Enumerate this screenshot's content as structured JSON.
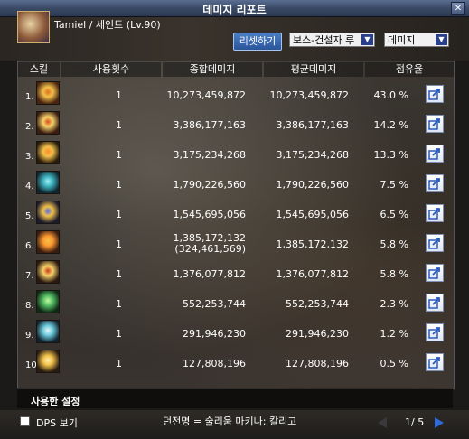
{
  "window": {
    "title": "데미지 리포트",
    "close_glyph": "✕"
  },
  "character": {
    "name": "Tamiel / 세인트 (Lv.90)"
  },
  "toolbar": {
    "reset_label": "리셋하기",
    "target_select": "보스-건설자 루",
    "mode_select": "데미지"
  },
  "table": {
    "headers": {
      "skill": "스킬",
      "count": "사용횟수",
      "total": "종합데미지",
      "avg": "평균데미지",
      "share": "점유율"
    },
    "rows": [
      {
        "rank": "1.",
        "count": "1",
        "total": "10,273,459,872",
        "avg": "10,273,459,872",
        "share": "43.0 %",
        "icon": "skill-icon-holy-1"
      },
      {
        "rank": "2.",
        "count": "1",
        "total": "3,386,177,163",
        "avg": "3,386,177,163",
        "share": "14.2 %",
        "icon": "skill-icon-holy-2"
      },
      {
        "rank": "3.",
        "count": "1",
        "total": "3,175,234,268",
        "avg": "3,175,234,268",
        "share": "13.3 %",
        "icon": "skill-icon-holy-3"
      },
      {
        "rank": "4.",
        "count": "1",
        "total": "1,790,226,560",
        "avg": "1,790,226,560",
        "share": "7.5 %",
        "icon": "skill-icon-holy-4"
      },
      {
        "rank": "5.",
        "count": "1",
        "total": "1,545,695,056",
        "avg": "1,545,695,056",
        "share": "6.5 %",
        "icon": "skill-icon-holy-5"
      },
      {
        "rank": "6.",
        "count": "1",
        "total": "1,385,172,132",
        "total_sub": "(324,461,569)",
        "avg": "1,385,172,132",
        "share": "5.8 %",
        "icon": "skill-icon-holy-6"
      },
      {
        "rank": "7.",
        "count": "1",
        "total": "1,376,077,812",
        "avg": "1,376,077,812",
        "share": "5.8 %",
        "icon": "skill-icon-holy-7"
      },
      {
        "rank": "8.",
        "count": "1",
        "total": "552,253,744",
        "avg": "552,253,744",
        "share": "2.3 %",
        "icon": "skill-icon-holy-8"
      },
      {
        "rank": "9.",
        "count": "1",
        "total": "291,946,230",
        "avg": "291,946,230",
        "share": "1.2 %",
        "icon": "skill-icon-holy-9"
      },
      {
        "rank": "10.",
        "count": "1",
        "total": "127,808,196",
        "avg": "127,808,196",
        "share": "0.5 %",
        "icon": "skill-icon-holy-10"
      }
    ]
  },
  "usage": {
    "label": "사용한 설정"
  },
  "footer": {
    "dps_label": "DPS 보기",
    "party_text": "던전명 = 술리움 마키나: 칼리고",
    "page": "1/ 5"
  },
  "colors": {
    "accent": "#2f6ad8",
    "icon_gold": "#f2c14a",
    "icon_orange": "#e0701e",
    "icon_teal": "#3fb4c0",
    "icon_green": "#57c267"
  }
}
